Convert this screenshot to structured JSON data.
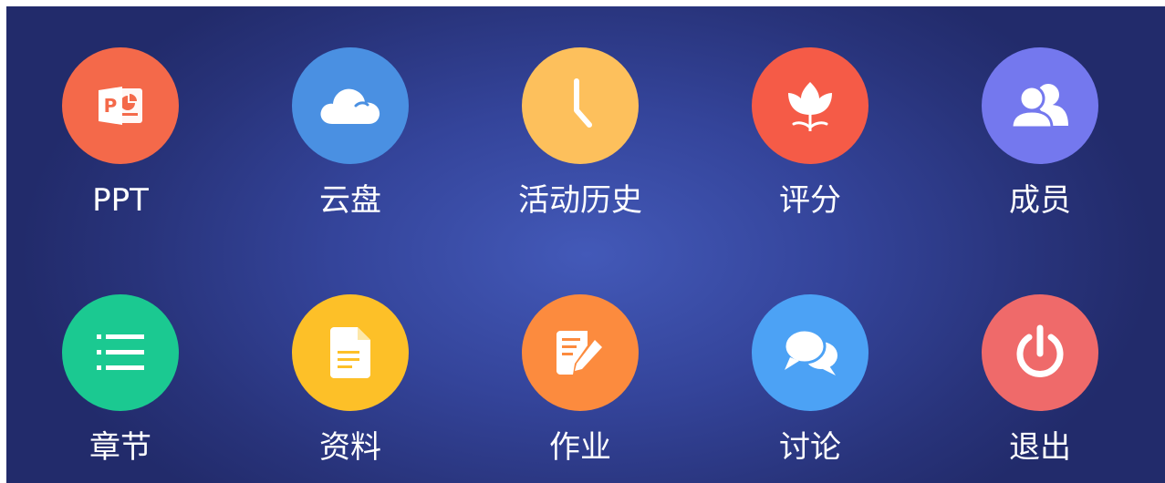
{
  "tiles": [
    {
      "label": "PPT",
      "icon": "ppt-icon",
      "color": "#f4694a"
    },
    {
      "label": "云盘",
      "icon": "cloud-icon",
      "color": "#4a90e2"
    },
    {
      "label": "活动历史",
      "icon": "clock-icon",
      "color": "#fdc05c"
    },
    {
      "label": "评分",
      "icon": "tulip-icon",
      "color": "#f55b47"
    },
    {
      "label": "成员",
      "icon": "members-icon",
      "color": "#7478ee"
    },
    {
      "label": "章节",
      "icon": "list-icon",
      "color": "#1bc991"
    },
    {
      "label": "资料",
      "icon": "document-icon",
      "color": "#fdc028"
    },
    {
      "label": "作业",
      "icon": "edit-icon",
      "color": "#fc8b3e"
    },
    {
      "label": "讨论",
      "icon": "chat-icon",
      "color": "#4ca2f5"
    },
    {
      "label": "退出",
      "icon": "power-icon",
      "color": "#ef6a6a"
    }
  ]
}
